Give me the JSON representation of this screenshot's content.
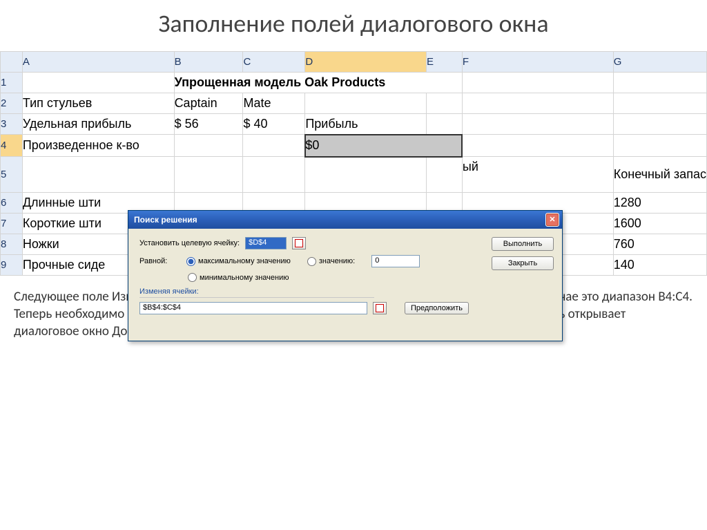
{
  "slide": {
    "title": "Заполнение полей диалогового окна"
  },
  "columns": [
    "A",
    "B",
    "C",
    "D",
    "E",
    "F",
    "G"
  ],
  "rows": [
    "1",
    "2",
    "3",
    "4",
    "5",
    "6",
    "7",
    "8",
    "9"
  ],
  "cells": {
    "B1": "Упрощенная модель Oak Products",
    "A2": "Тип стульев",
    "B2": "Captain",
    "C2": "Mate",
    "A3": "Удельная прибыль",
    "B3": "$ 56",
    "C3": "$ 40",
    "D3": "Прибыль",
    "A4": "Произведенное к-во",
    "E4": "$0",
    "F5_partial": "ый",
    "G5": "Конечный запас",
    "A6": "Длинные шти",
    "G6": "1280",
    "A7": "Короткие шти",
    "G7": "1600",
    "A8": "Ножки",
    "G8": "760",
    "A9": "Прочные сиде",
    "G9": "140"
  },
  "dialog": {
    "title": "Поиск решения",
    "target_label": "Установить целевую ячейку:",
    "target_value": "$D$4",
    "equal_label": "Равной:",
    "r_max": "максимальному значению",
    "r_val": "значению:",
    "r_min": "минимальному значению",
    "val_value": "0",
    "change_label": "Изменяя ячейки:",
    "change_value": "$B$4:$C$4",
    "btn_execute": "Выполнить",
    "btn_close": "Закрыть",
    "btn_guess": "Предположить"
  },
  "explain": {
    "text": "Следующее поле Изменяя ячейки позволяет указать переменные решения модели, в данном случае это диапазон B4:С4.\nТеперь необходимо задать для средства Поиск решения ограничения Щелчок на кнопке Добавить открывает диалоговое окно Добавление ограничения, которое  позволяет вводить ограничения."
  }
}
